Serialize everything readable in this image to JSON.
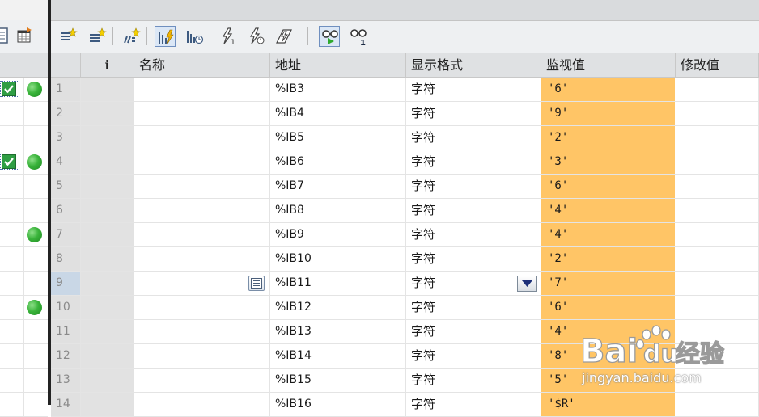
{
  "columns": {
    "info": "i",
    "name": "名称",
    "address": "地址",
    "display_format": "显示格式",
    "monitor_value": "监视值",
    "modify_value": "修改值"
  },
  "rows": [
    {
      "no": "1",
      "name": "",
      "address": "%IB3",
      "format": "字符",
      "monitor": "'6'"
    },
    {
      "no": "2",
      "name": "",
      "address": "%IB4",
      "format": "字符",
      "monitor": "'9'"
    },
    {
      "no": "3",
      "name": "",
      "address": "%IB5",
      "format": "字符",
      "monitor": "'2'"
    },
    {
      "no": "4",
      "name": "",
      "address": "%IB6",
      "format": "字符",
      "monitor": "'3'"
    },
    {
      "no": "5",
      "name": "",
      "address": "%IB7",
      "format": "字符",
      "monitor": "'6'"
    },
    {
      "no": "6",
      "name": "",
      "address": "%IB8",
      "format": "字符",
      "monitor": "'4'"
    },
    {
      "no": "7",
      "name": "",
      "address": "%IB9",
      "format": "字符",
      "monitor": "'4'"
    },
    {
      "no": "8",
      "name": "",
      "address": "%IB10",
      "format": "字符",
      "monitor": "'2'"
    },
    {
      "no": "9",
      "name": "",
      "address": "%IB11",
      "format": "字符",
      "monitor": "'7'"
    },
    {
      "no": "10",
      "name": "",
      "address": "%IB12",
      "format": "字符",
      "monitor": "'6'"
    },
    {
      "no": "11",
      "name": "",
      "address": "%IB13",
      "format": "字符",
      "monitor": "'4'"
    },
    {
      "no": "12",
      "name": "",
      "address": "%IB14",
      "format": "字符",
      "monitor": "'8'"
    },
    {
      "no": "13",
      "name": "",
      "address": "%IB15",
      "format": "字符",
      "monitor": "'5'"
    },
    {
      "no": "14",
      "name": "",
      "address": "%IB16",
      "format": "字符",
      "monitor": "'$R'"
    }
  ],
  "left_status": [
    {
      "checked": true,
      "active": true
    },
    {
      "checked": false,
      "active": false
    },
    {
      "checked": false,
      "active": false
    },
    {
      "checked": true,
      "active": true
    },
    {
      "checked": false,
      "active": false
    },
    {
      "checked": false,
      "active": false
    },
    {
      "checked": false,
      "active": true
    },
    {
      "checked": false,
      "active": false
    },
    {
      "checked": false,
      "active": false
    },
    {
      "checked": false,
      "active": true
    },
    {
      "checked": false,
      "active": false
    },
    {
      "checked": false,
      "active": false
    },
    {
      "checked": false,
      "active": false
    },
    {
      "checked": false,
      "active": false
    }
  ],
  "selected_row": "9",
  "colors": {
    "monitor_bg": "#ffc566",
    "status_green": "#39b33a",
    "check_green": "#2f9e44",
    "splitter": "#232323"
  },
  "toolbar_icons": [
    "insert-row-icon",
    "add-row-icon",
    "insert-comment-row-icon",
    "trigger-monitor-icon",
    "trigger-time-icon",
    "modify-now-icon",
    "modify-trigger-icon",
    "enable-peripheral-icon",
    "monitor-all-icon",
    "monitor-once-icon"
  ],
  "watermark": {
    "logo_left": "Bai",
    "logo_right": "du",
    "logo_cn": "经验",
    "url": "jingyan.baidu.com"
  }
}
